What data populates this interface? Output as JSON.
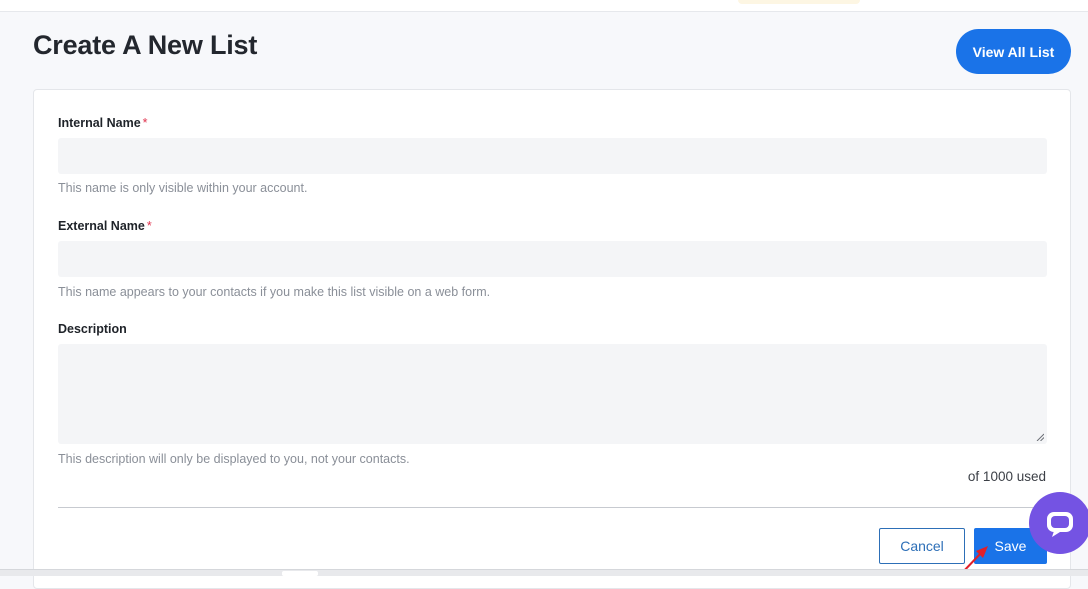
{
  "page": {
    "title": "Create A New List",
    "view_all_label": "View All List"
  },
  "form": {
    "internal_name": {
      "label": "Internal Name",
      "required_mark": "*",
      "value": "",
      "help": "This name is only visible within your account."
    },
    "external_name": {
      "label": "External Name",
      "required_mark": "*",
      "value": "",
      "help": "This name appears to your contacts if you make this list visible on a web form."
    },
    "description": {
      "label": "Description",
      "value": "",
      "help": "This description will only be displayed to you, not your contacts.",
      "counter": "of 1000 used"
    },
    "cancel_label": "Cancel",
    "save_label": "Save"
  },
  "colors": {
    "accent": "#1a73e8",
    "required": "#e0334e",
    "chat_widget": "#7453e3",
    "annotation_arrow": "#e0202a"
  },
  "icons": {
    "chat_widget": "chat-icon",
    "annotation": "arrow-icon"
  }
}
